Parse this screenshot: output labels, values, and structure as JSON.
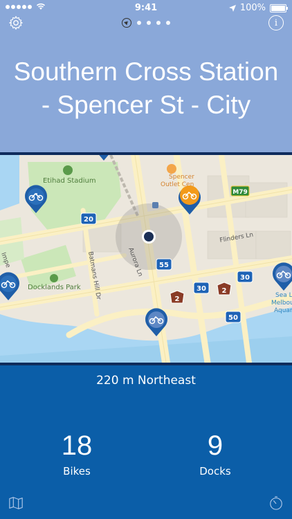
{
  "status_bar": {
    "time": "9:41",
    "battery": "100%"
  },
  "header": {
    "title_line1": "Southern Cross Station",
    "title_line2": "- Spencer St - City"
  },
  "map": {
    "labels": {
      "etihad": "Etihad Stadium",
      "spencer": "Spencer",
      "outlet": "Outlet Cen",
      "docklands": "Docklands Park",
      "flinders": "Flinders Ln",
      "batmans": "Batmans Hill Dr",
      "aurora": "Aurora Ln",
      "imperial": "Impe",
      "sealife1": "Sea L",
      "sealife2": "Melbou",
      "sealife3": "Aquari",
      "route20": "20",
      "route55": "55",
      "route30a": "30",
      "route30b": "30",
      "route50": "50",
      "route2a": "2",
      "route2b": "2",
      "m79": "M79"
    },
    "colors": {
      "water": "#a6d4f2",
      "park": "#c5e5b4",
      "road": "#fbf2c9",
      "pin": "#1f5ea8",
      "pin_selected": "#f29a1a"
    }
  },
  "info": {
    "distance": "220 m Northeast"
  },
  "stats": {
    "bikes_count": "18",
    "bikes_label": "Bikes",
    "docks_count": "9",
    "docks_label": "Docks"
  }
}
